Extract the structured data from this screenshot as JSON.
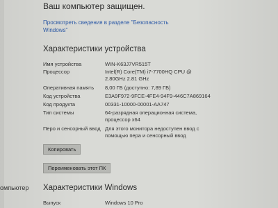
{
  "sidebar": {
    "partial_label": "омпьютер"
  },
  "header": {
    "protected_text": "Ваш компьютер защищен.",
    "security_link": "Просмотреть сведения в разделе \"Безопасность Windows\""
  },
  "device_specs": {
    "title": "Характеристики устройства",
    "rows": [
      {
        "label": "Имя устройства",
        "value": "WIN-K63J7VR515T"
      },
      {
        "label": "Процессор",
        "value": "Intel(R) Core(TM) i7-7700HQ CPU @\n2.80GHz   2.81 GHz"
      },
      {
        "label": "Оперативная память",
        "value": "8,00 ГБ (доступно: 7,89 ГБ)"
      },
      {
        "label": "Код устройства",
        "value": "E3A9F972-9FCE-4FE4-94F9-446C7A869164"
      },
      {
        "label": "Код продукта",
        "value": "00331-10000-00001-AA747"
      },
      {
        "label": "Тип системы",
        "value": "64-разрядная операционная система,\nпроцессор x64"
      },
      {
        "label": "Перо и сенсорный ввод",
        "value": "Для этого монитора недоступен ввод с\nпомощью пера и сенсорный ввод"
      }
    ],
    "copy_button": "Копировать",
    "rename_button": "Переименовать этот ПК"
  },
  "windows_specs": {
    "title": "Характеристики Windows",
    "rows": [
      {
        "label": "Выпуск",
        "value": "Windows 10 Pro"
      }
    ]
  }
}
